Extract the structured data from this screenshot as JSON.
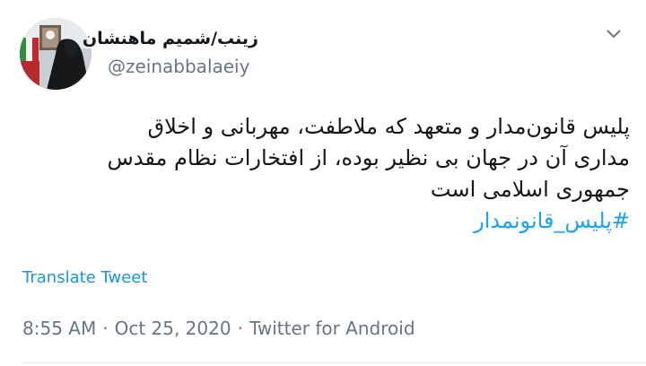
{
  "tweet": {
    "display_name": "زینب/شمیم ماهنشان",
    "handle": "@zeinabbalaeiy",
    "text_lines": [
      "پلیس قانون‌مدار و متعهد که ملاطفت، مهربانی و اخلاق",
      "مداری آن در جهان بی نظیر بوده،  از افتخارات نظام مقدس",
      "جمهوری اسلامی است"
    ],
    "hashtag": "#پلیس_قانونمدار",
    "translate_label": "Translate Tweet",
    "time": "8:55 AM",
    "date": "Oct 25, 2020",
    "source": "Twitter for Android",
    "separator": "·"
  },
  "icons": {
    "menu": "chevron-down-icon",
    "avatar": "profile-photo"
  },
  "colors": {
    "text": "#14171a",
    "muted": "#657786",
    "link": "#1da1f2",
    "translate": "#1b95e0",
    "divider": "#e1e8ed"
  }
}
